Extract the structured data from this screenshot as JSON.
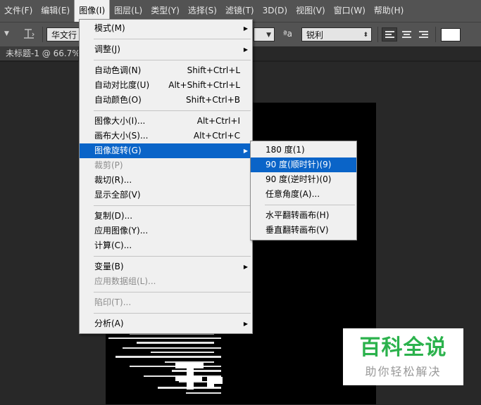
{
  "menubar": {
    "items": [
      "文件(F)",
      "编辑(E)",
      "图像(I)",
      "图层(L)",
      "类型(Y)",
      "选择(S)",
      "滤镜(T)",
      "3D(D)",
      "视图(V)",
      "窗口(W)",
      "帮助(H)"
    ]
  },
  "options": {
    "font_family": "华文行",
    "aa_glyph": "ªa",
    "aa_mode": "锐利",
    "swatch_color": "#ffffff"
  },
  "document": {
    "tab_label": "未标题-1 @ 66.7%"
  },
  "image_menu": {
    "items": [
      {
        "label": "模式(M)",
        "submenu": true
      },
      {
        "sep": true
      },
      {
        "label": "调整(J)",
        "submenu": true
      },
      {
        "sep": true
      },
      {
        "label": "自动色调(N)",
        "shortcut": "Shift+Ctrl+L"
      },
      {
        "label": "自动对比度(U)",
        "shortcut": "Alt+Shift+Ctrl+L"
      },
      {
        "label": "自动颜色(O)",
        "shortcut": "Shift+Ctrl+B"
      },
      {
        "sep": true
      },
      {
        "label": "图像大小(I)...",
        "shortcut": "Alt+Ctrl+I"
      },
      {
        "label": "画布大小(S)...",
        "shortcut": "Alt+Ctrl+C"
      },
      {
        "label": "图像旋转(G)",
        "submenu": true,
        "highlighted": true
      },
      {
        "label": "裁剪(P)",
        "disabled": true
      },
      {
        "label": "裁切(R)..."
      },
      {
        "label": "显示全部(V)"
      },
      {
        "sep": true
      },
      {
        "label": "复制(D)..."
      },
      {
        "label": "应用图像(Y)..."
      },
      {
        "label": "计算(C)..."
      },
      {
        "sep": true
      },
      {
        "label": "变量(B)",
        "submenu": true
      },
      {
        "label": "应用数据组(L)...",
        "disabled": true
      },
      {
        "sep": true
      },
      {
        "label": "陷印(T)...",
        "disabled": true
      },
      {
        "sep": true
      },
      {
        "label": "分析(A)",
        "submenu": true
      }
    ]
  },
  "rotate_submenu": {
    "items": [
      {
        "label": "180 度(1)"
      },
      {
        "label": "90 度(顺时针)(9)",
        "highlighted": true
      },
      {
        "label": "90 度(逆时针)(0)"
      },
      {
        "label": "任意角度(A)..."
      },
      {
        "sep": true
      },
      {
        "label": "水平翻转画布(H)"
      },
      {
        "label": "垂直翻转画布(V)"
      }
    ]
  },
  "watermark": {
    "title": "百科全说",
    "subtitle": "助你轻松解决"
  }
}
